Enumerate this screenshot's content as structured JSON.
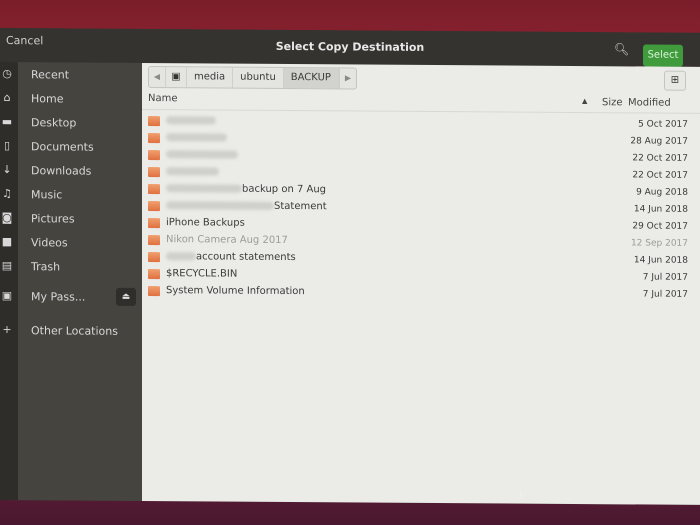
{
  "header": {
    "cancel_label": "Cancel",
    "title": "Select Copy Destination",
    "search_icon": "search-icon",
    "select_label": "Select",
    "accent_color": "#3f9b3c"
  },
  "sidebar": {
    "items": [
      {
        "label": "Recent",
        "icon": "clock-icon",
        "glyph": "◷"
      },
      {
        "label": "Home",
        "icon": "home-icon",
        "glyph": "⌂"
      },
      {
        "label": "Desktop",
        "icon": "folder-icon",
        "glyph": "▬"
      },
      {
        "label": "Documents",
        "icon": "document-icon",
        "glyph": "▯"
      },
      {
        "label": "Downloads",
        "icon": "download-icon",
        "glyph": "↓"
      },
      {
        "label": "Music",
        "icon": "music-icon",
        "glyph": "♫"
      },
      {
        "label": "Pictures",
        "icon": "camera-icon",
        "glyph": "◙"
      },
      {
        "label": "Videos",
        "icon": "video-icon",
        "glyph": "■"
      },
      {
        "label": "Trash",
        "icon": "trash-icon",
        "glyph": "▤"
      },
      {
        "label": "My Pass...",
        "icon": "drive-icon",
        "glyph": "▣",
        "eject": true
      },
      {
        "label": "Other Locations",
        "icon": "plus-icon",
        "glyph": "+"
      }
    ]
  },
  "pathbar": {
    "segments": [
      "media",
      "ubuntu",
      "BACKUP"
    ],
    "active": "BACKUP"
  },
  "columns": {
    "name": "Name",
    "size": "Size",
    "modified": "Modified"
  },
  "files": [
    {
      "name_visible": "",
      "blurred": true,
      "date": "5 Oct 2017"
    },
    {
      "name_visible": "",
      "blurred": true,
      "date": "28 Aug 2017"
    },
    {
      "name_visible": "",
      "blurred": true,
      "date": "22 Oct 2017"
    },
    {
      "name_visible": "",
      "blurred": true,
      "date": "22 Oct 2017"
    },
    {
      "name_visible": "backup on 7 Aug",
      "blurred": true,
      "date": "9 Aug 2018"
    },
    {
      "name_visible": "Statement",
      "blurred": true,
      "date": "14 Jun 2018"
    },
    {
      "name_visible": "iPhone Backups",
      "blurred": false,
      "date": "29 Oct 2017"
    },
    {
      "name_visible": "Nikon Camera Aug 2017",
      "blurred": false,
      "date": "12 Sep 2017",
      "dim": true
    },
    {
      "name_visible": "account statements",
      "blurred": true,
      "date": "14 Jun 2018"
    },
    {
      "name_visible": "$RECYCLE.BIN",
      "blurred": false,
      "date": "7 Jul 2017"
    },
    {
      "name_visible": "System Volume Information",
      "blurred": false,
      "date": "7 Jul 2017"
    }
  ]
}
